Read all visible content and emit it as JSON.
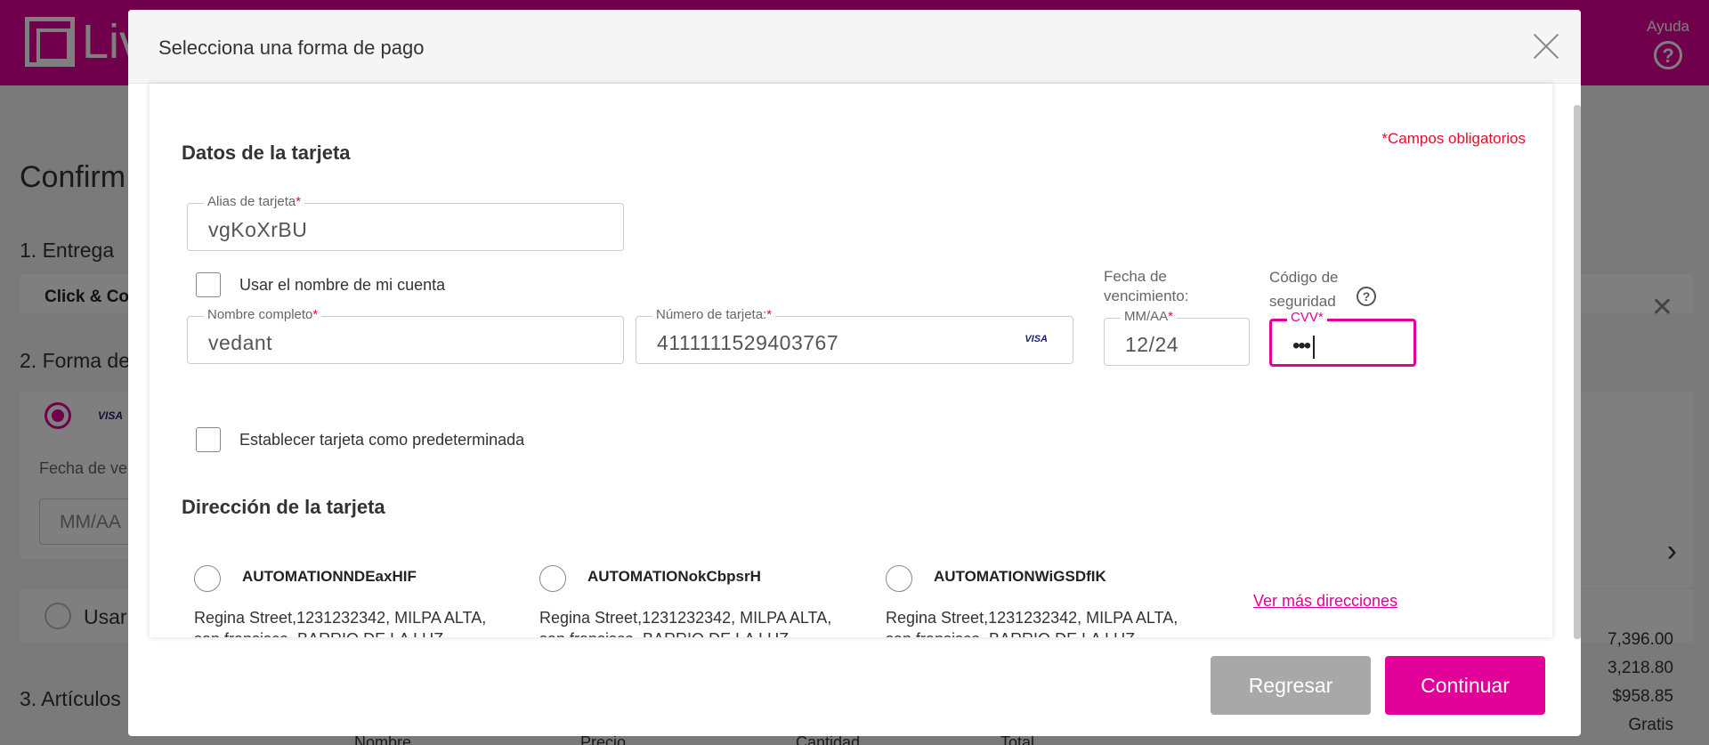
{
  "background": {
    "logo_text": "Liv",
    "help_label": "Ayuda",
    "help_icon": "question-circle-icon",
    "page_title": "Confirm",
    "step_delivery": "1. Entrega",
    "click_collect": "Click & Co",
    "step_payment": "2. Forma de",
    "visa_text": "VISA",
    "expiry_label": "Fecha de ve",
    "expiry_placeholder": "MM/AA",
    "use_label": "Usar",
    "step_items": "3. Artículos",
    "amounts": [
      "7,396.00",
      "3,218.80",
      "$958.85",
      "Gratis"
    ],
    "columns": [
      "Nombre",
      "Precio",
      "Cantidad",
      "Total"
    ],
    "brand_color": "#e10098"
  },
  "modal": {
    "title": "Selecciona una forma de pago",
    "close_icon": "close-icon",
    "card_section_title": "Datos de la tarjeta",
    "required_note": "*Campos obligatorios",
    "alias": {
      "label": "Alias de tarjeta",
      "required": "*",
      "value": "vgKoXrBU"
    },
    "use_account_name": "Usar el nombre de mi cuenta",
    "full_name": {
      "label": "Nombre completo",
      "required": "*",
      "value": "vedant"
    },
    "card_number": {
      "label": "Número de tarjeta:",
      "required": "*",
      "value": "4111111529403767",
      "brand": "VISA"
    },
    "expiry": {
      "title": "Fecha de vencimiento:",
      "label": "MM/AA",
      "required": "*",
      "value": "12/24"
    },
    "cvv": {
      "title": "Código de seguridad",
      "label": "CVV",
      "required": "*",
      "value": "•••"
    },
    "set_default": "Establecer tarjeta como predeterminada",
    "address_section_title": "Dirección de la tarjeta",
    "addresses": [
      {
        "name": "AUTOMATIONNDEaxHIF",
        "line1": "Regina Street,1231232342, MILPA ALTA,",
        "line2": "san fransisco, BARRIO DE LA LUZ"
      },
      {
        "name": "AUTOMATIONokCbpsrH",
        "line1": "Regina Street,1231232342, MILPA ALTA,",
        "line2": "san fransisco, BARRIO DE LA LUZ"
      },
      {
        "name": "AUTOMATIONWiGSDfIK",
        "line1": "Regina Street,1231232342, MILPA ALTA,",
        "line2": "san fransisco, BARRIO DE LA LUZ"
      }
    ],
    "more_addresses": "Ver más direcciones",
    "back_button": "Regresar",
    "continue_button": "Continuar",
    "accent_color": "#e10098",
    "required_color": "#e0102a"
  }
}
